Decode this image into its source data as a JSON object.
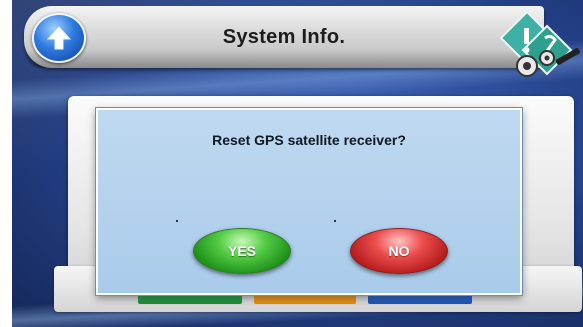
{
  "header": {
    "title": "System Info."
  },
  "dialog": {
    "message": "Reset GPS satellite receiver?",
    "yes_label": "YES",
    "no_label": "NO"
  },
  "colors": {
    "yes_button": "#3fb634",
    "no_button": "#d23434",
    "dialog_bg": "#b4d2ee",
    "tab_green": "#2aa84a",
    "tab_orange": "#ff9f1a",
    "tab_blue": "#2f6fd6"
  },
  "icons": {
    "back": "up-arrow-icon",
    "settings": "settings-gears-icon"
  }
}
